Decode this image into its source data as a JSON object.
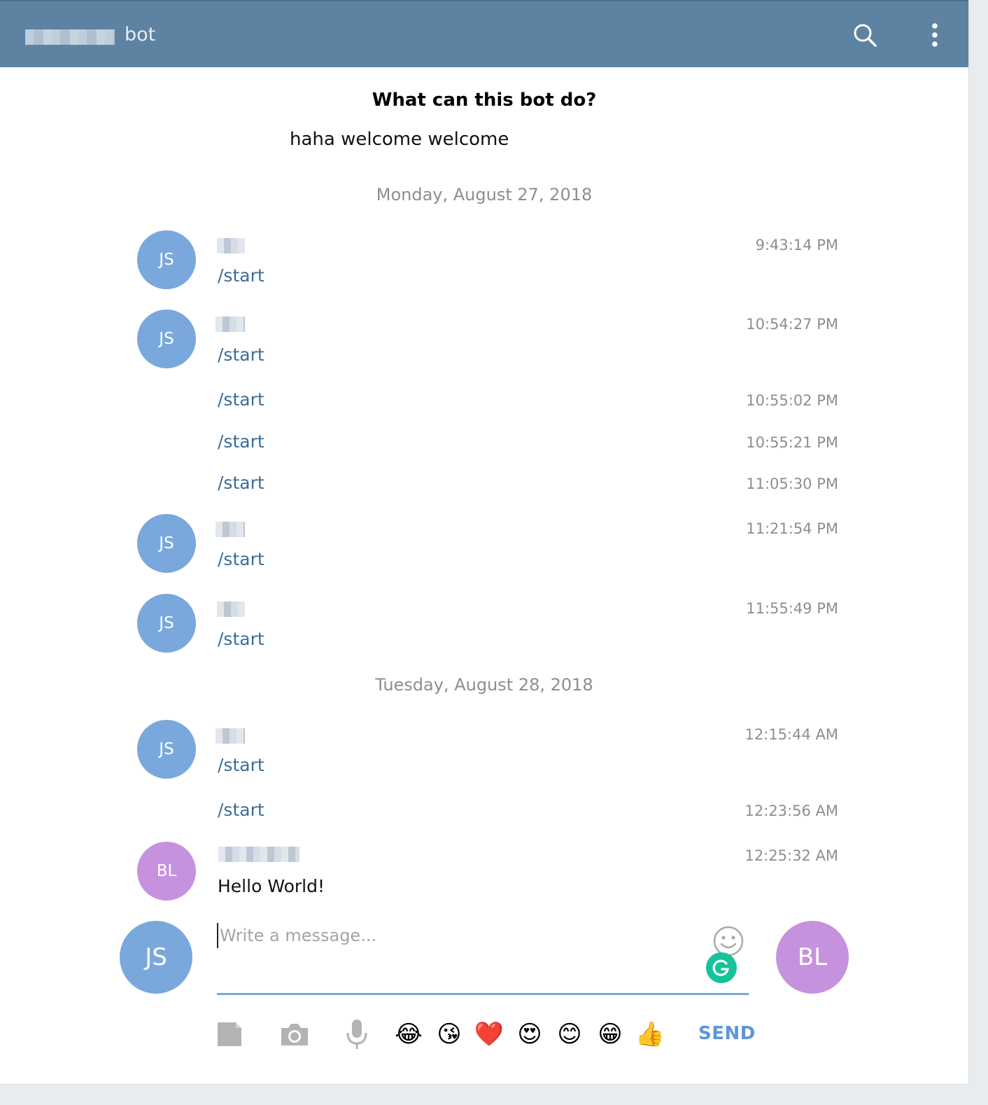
{
  "header": {
    "title": "bot",
    "icons": [
      "search-icon",
      "more-vertical-icon"
    ]
  },
  "intro": {
    "title": "What can this bot do?",
    "text": "haha welcome welcome"
  },
  "dates": [
    "Monday, August 27, 2018",
    "Tuesday, August 28, 2018"
  ],
  "messages": [
    {
      "avatar": "JS",
      "text": "/start",
      "time": "9:43:14 PM"
    },
    {
      "avatar": "JS",
      "text": "/start",
      "time": "10:54:27 PM"
    },
    {
      "avatar": "",
      "text": "/start",
      "time": "10:55:02 PM"
    },
    {
      "avatar": "",
      "text": "/start",
      "time": "10:55:21 PM"
    },
    {
      "avatar": "",
      "text": "/start",
      "time": "11:05:30 PM"
    },
    {
      "avatar": "JS",
      "text": "/start",
      "time": "11:21:54 PM"
    },
    {
      "avatar": "JS",
      "text": "/start",
      "time": "11:55:49 PM"
    },
    {
      "avatar": "JS",
      "text": "/start",
      "time": "12:15:44 AM"
    },
    {
      "avatar": "",
      "text": "/start",
      "time": "12:23:56 AM"
    },
    {
      "avatar": "BL",
      "text": "Hello World!",
      "time": "12:25:32 AM"
    }
  ],
  "composer": {
    "placeholder": "Write a message...",
    "self_avatar": "JS",
    "peer_avatar": "BL",
    "send_label": "SEND",
    "tools": [
      "document-icon",
      "camera-icon",
      "microphone-icon"
    ],
    "quick_emojis": [
      "😂",
      "😘",
      "❤️",
      "😍",
      "😊",
      "😁",
      "👍"
    ]
  },
  "colors": {
    "header": "#5d82a2",
    "avatar_js": "#7aa8dc",
    "avatar_bl": "#c692de",
    "command_text": "#3a6d99",
    "send": "#5f96d6"
  }
}
